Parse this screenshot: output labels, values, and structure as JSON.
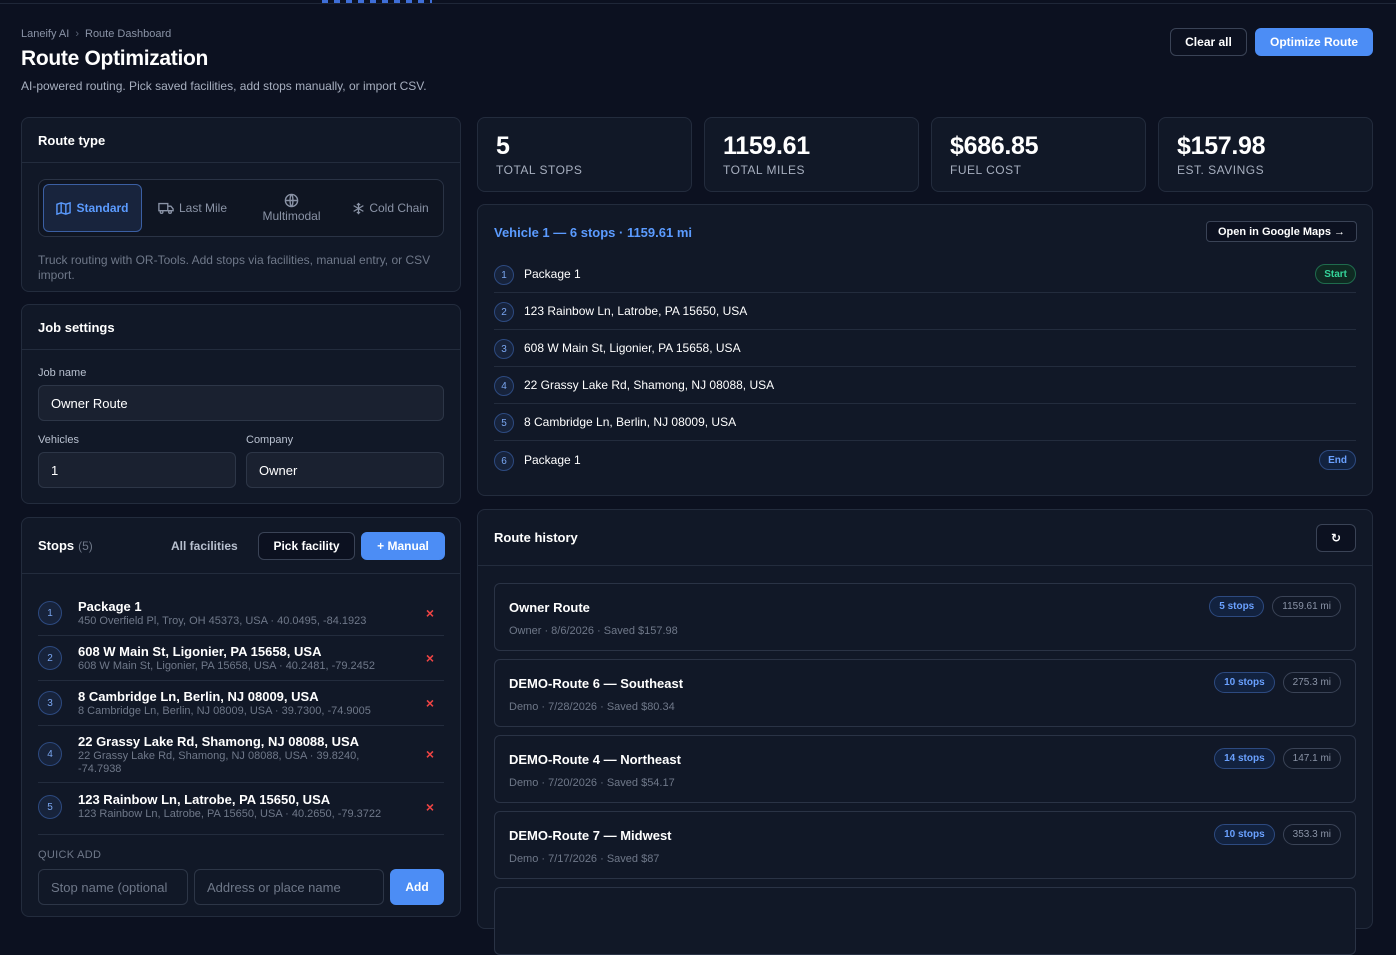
{
  "breadcrumb": {
    "root": "Laneify AI",
    "sep": "›",
    "current": "Route Dashboard"
  },
  "header": {
    "title": "Route Optimization",
    "subtitle": "AI-powered routing. Pick saved facilities, add stops manually, or import CSV.",
    "clear_label": "Clear all",
    "optimize_label": "Optimize Route"
  },
  "route_type": {
    "heading": "Route type",
    "options": [
      "Standard",
      "Last Mile",
      "Multimodal",
      "Cold Chain"
    ],
    "selected": "Standard",
    "description": "Truck routing with OR-Tools. Add stops via facilities, manual entry, or CSV import."
  },
  "job": {
    "heading": "Job settings",
    "name_label": "Job name",
    "name_value": "Owner Route",
    "vehicles_label": "Vehicles",
    "vehicles_value": "1",
    "company_label": "Company",
    "company_value": "Owner"
  },
  "stops": {
    "heading": "Stops",
    "count": "(5)",
    "all_facilities": "All facilities",
    "pick_label": "Pick facility",
    "manual_label": "+ Manual",
    "remove_glyph": "×",
    "items": [
      {
        "n": "1",
        "name": "Package 1",
        "addr": "450 Overfield Pl, Troy, OH 45373, USA · 40.0495, -84.1923"
      },
      {
        "n": "2",
        "name": "608 W Main St, Ligonier, PA 15658, USA",
        "addr": "608 W Main St, Ligonier, PA 15658, USA · 40.2481, -79.2452"
      },
      {
        "n": "3",
        "name": "8 Cambridge Ln, Berlin, NJ 08009, USA",
        "addr": "8 Cambridge Ln, Berlin, NJ 08009, USA · 39.7300, -74.9005"
      },
      {
        "n": "4",
        "name": "22 Grassy Lake Rd, Shamong, NJ 08088, USA",
        "addr": "22 Grassy Lake Rd, Shamong, NJ 08088, USA · 39.8240, -74.7938"
      },
      {
        "n": "5",
        "name": "123 Rainbow Ln, Latrobe, PA 15650, USA",
        "addr": "123 Rainbow Ln, Latrobe, PA 15650, USA · 40.2650, -79.3722"
      }
    ],
    "quick_add_label": "QUICK ADD",
    "stop_name_placeholder": "Stop name (optional",
    "address_placeholder": "Address or place name",
    "add_label": "Add"
  },
  "stats": [
    {
      "value": "5",
      "label": "TOTAL STOPS"
    },
    {
      "value": "1159.61",
      "label": "TOTAL MILES"
    },
    {
      "value": "$686.85",
      "label": "FUEL COST"
    },
    {
      "value": "$157.98",
      "label": "EST. SAVINGS"
    }
  ],
  "vehicle": {
    "title": "Vehicle 1 — 6 stops · 1159.61 mi",
    "maps_label": "Open in Google Maps →",
    "start_label": "Start",
    "end_label": "End",
    "rows": [
      {
        "n": "1",
        "text": "Package 1"
      },
      {
        "n": "2",
        "text": "123 Rainbow Ln, Latrobe, PA 15650, USA"
      },
      {
        "n": "3",
        "text": "608 W Main St, Ligonier, PA 15658, USA"
      },
      {
        "n": "4",
        "text": "22 Grassy Lake Rd, Shamong, NJ 08088, USA"
      },
      {
        "n": "5",
        "text": "8 Cambridge Ln, Berlin, NJ 08009, USA"
      },
      {
        "n": "6",
        "text": "Package 1"
      }
    ]
  },
  "history": {
    "heading": "Route history",
    "refresh_glyph": "↻",
    "items": [
      {
        "title": "Owner Route",
        "meta": "Owner · 8/6/2026 · Saved $157.98",
        "stops": "5 stops",
        "miles": "1159.61 mi"
      },
      {
        "title": "DEMO-Route 6 — Southeast",
        "meta": "Demo · 7/28/2026 · Saved $80.34",
        "stops": "10 stops",
        "miles": "275.3 mi"
      },
      {
        "title": "DEMO-Route 4 — Northeast",
        "meta": "Demo · 7/20/2026 · Saved $54.17",
        "stops": "14 stops",
        "miles": "147.1 mi"
      },
      {
        "title": "DEMO-Route 7 — Midwest",
        "meta": "Demo · 7/17/2026 · Saved $87",
        "stops": "10 stops",
        "miles": "353.3 mi"
      }
    ]
  },
  "colors": {
    "accent": "#4c8df5",
    "background": "#0c1120",
    "card": "#111827",
    "danger": "#ef4444",
    "success": "#34d399"
  }
}
